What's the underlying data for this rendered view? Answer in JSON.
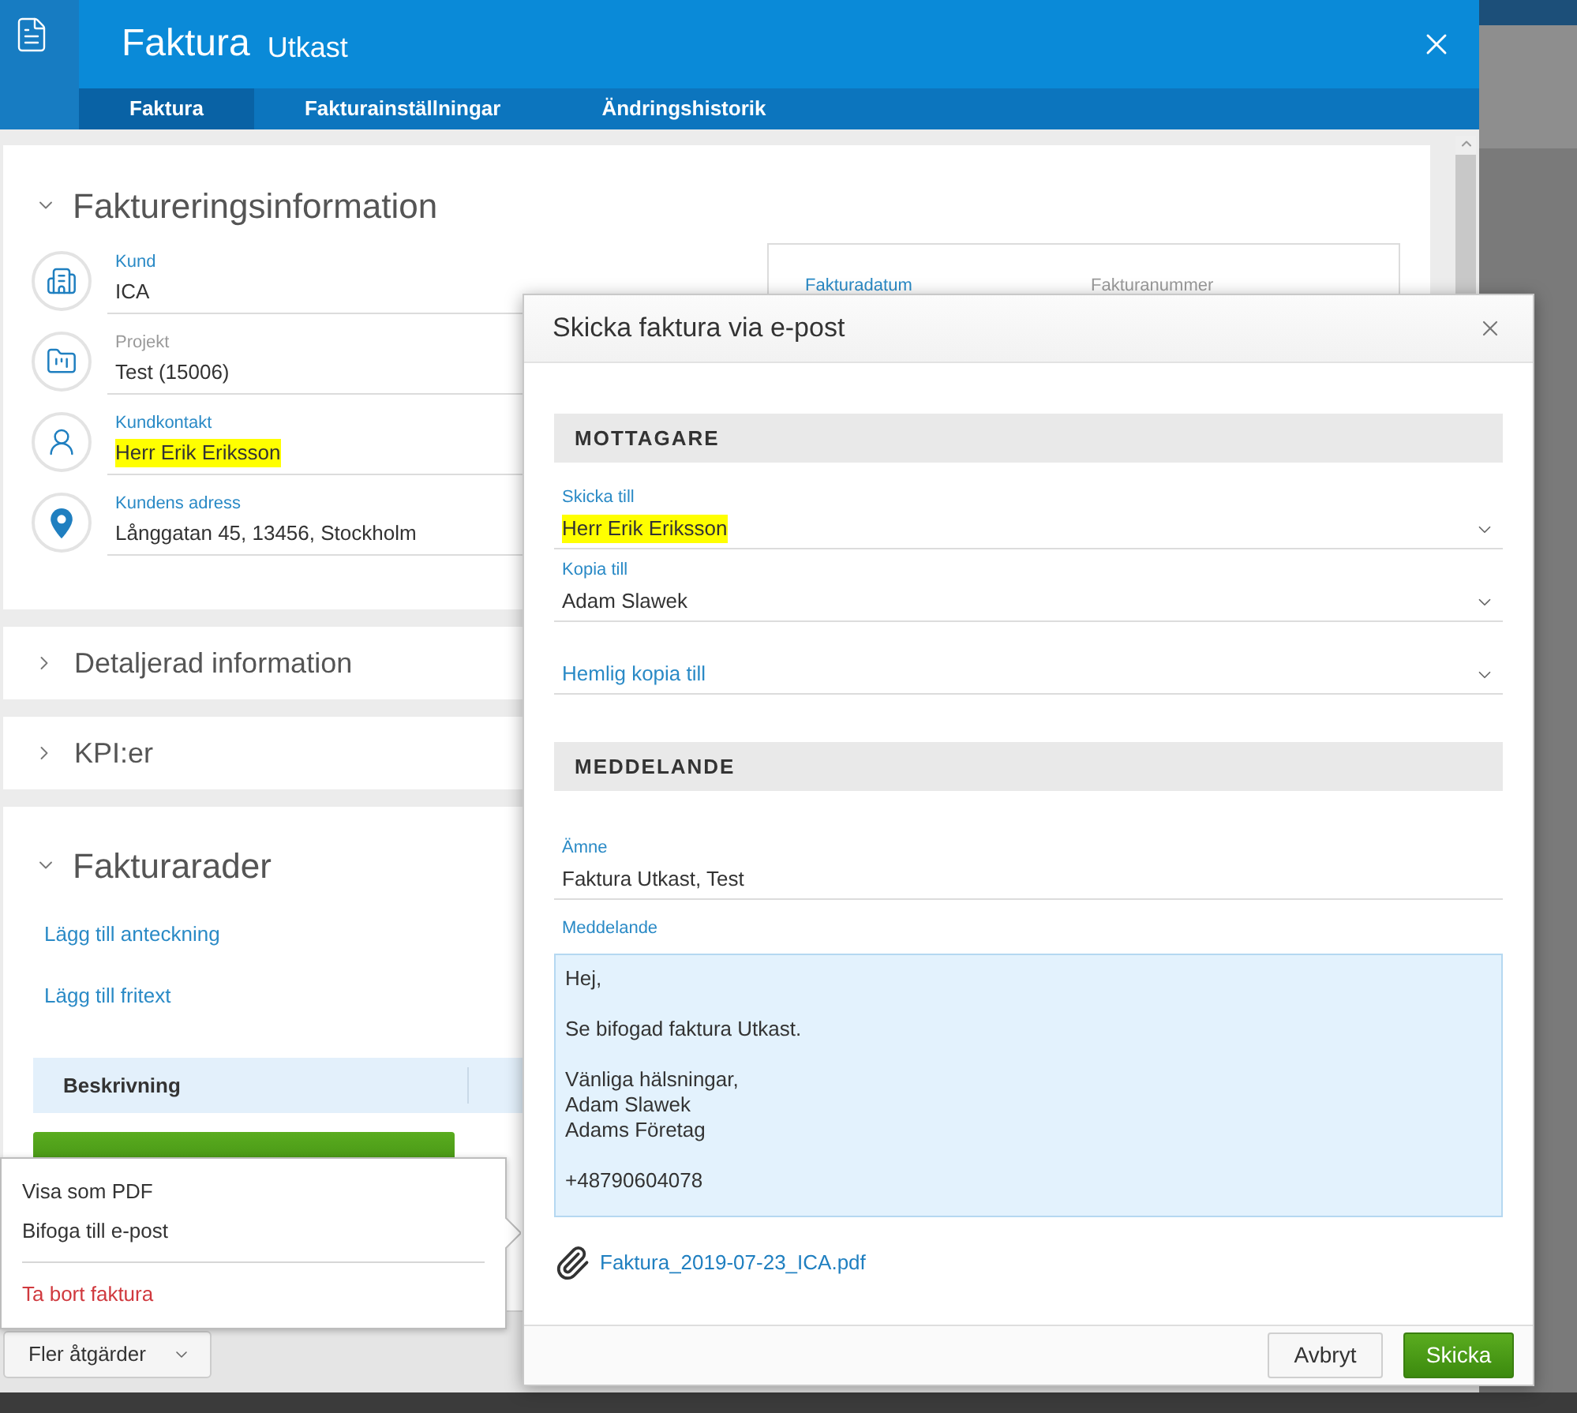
{
  "window": {
    "title": "Faktura",
    "status": "Utkast"
  },
  "tabs": [
    {
      "label": "Faktura",
      "selected": true
    },
    {
      "label": "Fakturainställningar",
      "selected": false
    },
    {
      "label": "Ändringshistorik",
      "selected": false
    }
  ],
  "billing_info": {
    "title": "Faktureringsinformation",
    "expanded": true,
    "fields": [
      {
        "kind": "customer",
        "label": "Kund",
        "value": "ICA",
        "disabled": false,
        "highlighted": false
      },
      {
        "kind": "project",
        "label": "Projekt",
        "value": "Test (15006)",
        "disabled": true,
        "highlighted": false
      },
      {
        "kind": "contact",
        "label": "Kundkontakt",
        "value": "Herr Erik Eriksson",
        "disabled": false,
        "highlighted": true
      },
      {
        "kind": "address",
        "label": "Kundens adress",
        "value": "Långgatan 45, 13456, Stockholm",
        "disabled": false,
        "highlighted": false
      }
    ],
    "invoice_details": [
      {
        "label": "Fakturadatum",
        "disabled": false
      },
      {
        "label": "Fakturanummer",
        "disabled": true
      }
    ]
  },
  "sections": [
    {
      "title": "Detaljerad information",
      "expanded": false
    },
    {
      "title": "KPI:er",
      "expanded": false
    }
  ],
  "invoice_rows": {
    "title": "Fakturarader",
    "expanded": true,
    "links": [
      "Lägg till anteckning",
      "Lägg till fritext"
    ],
    "columns": [
      "Beskrivning"
    ]
  },
  "actions_menu": {
    "items": [
      {
        "label": "Visa som PDF",
        "kind": "normal"
      },
      {
        "label": "Bifoga till e-post",
        "kind": "normal"
      },
      {
        "label": "Ta bort faktura",
        "kind": "danger"
      }
    ]
  },
  "footer": {
    "more_button": "Fler åtgärder"
  },
  "email_dialog": {
    "title": "Skicka faktura via e-post",
    "sections": [
      {
        "title": "MOTTAGARE",
        "fields": [
          {
            "kind": "select",
            "label": "Skicka till",
            "value": "Herr Erik Eriksson",
            "highlighted": true
          },
          {
            "kind": "select",
            "label": "Kopia till",
            "value": "Adam Slawek",
            "highlighted": false
          },
          {
            "kind": "select",
            "placeholder": "Hemlig kopia till",
            "highlighted": false
          }
        ]
      },
      {
        "title": "MEDDELANDE",
        "fields": [
          {
            "kind": "text",
            "label": "Ämne",
            "value": "Faktura Utkast, Test",
            "highlighted": false
          },
          {
            "kind": "textarea",
            "label": "Meddelande",
            "value": "Hej,\n\nSe bifogad faktura Utkast.\n\nVänliga hälsningar,\nAdam Slawek\nAdams Företag\n\n+48790604078",
            "highlighted": false
          }
        ]
      }
    ],
    "attachment": "Faktura_2019-07-23_ICA.pdf",
    "buttons": [
      {
        "label": "Avbryt",
        "kind": "secondary"
      },
      {
        "label": "Skicka",
        "kind": "primary"
      }
    ]
  }
}
